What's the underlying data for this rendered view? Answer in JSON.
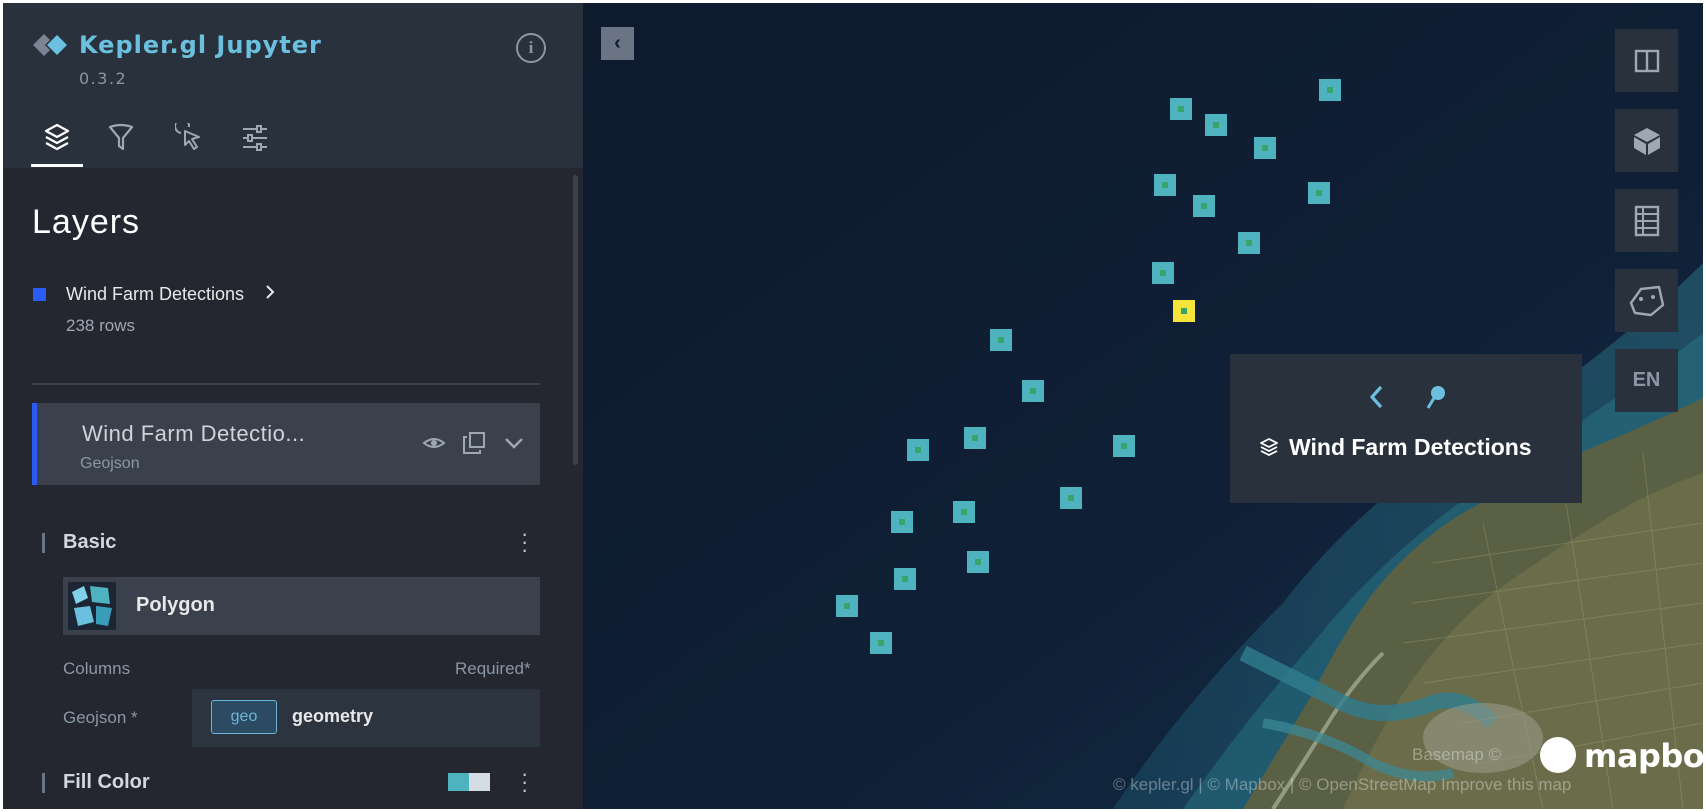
{
  "app": {
    "title": "Kepler.gl Jupyter",
    "version": "0.3.2"
  },
  "tabs": [
    {
      "icon": "layers-icon",
      "active": true
    },
    {
      "icon": "filter-icon",
      "active": false
    },
    {
      "icon": "interaction-icon",
      "active": false
    },
    {
      "icon": "map-settings-icon",
      "active": false
    }
  ],
  "panel": {
    "heading": "Layers",
    "dataset": {
      "name": "Wind Farm Detections",
      "rows": "238 rows",
      "color": "#2a5bf2"
    },
    "layer": {
      "name": "Wind Farm Detectio...",
      "type": "Geojson"
    },
    "basic": {
      "title": "Basic",
      "layer_type": "Polygon"
    },
    "columns": {
      "label": "Columns",
      "required": "Required*",
      "field_label": "Geojson *",
      "tag": "geo",
      "value": "geometry"
    },
    "fill": {
      "title": "Fill Color"
    }
  },
  "map": {
    "lang_button": "EN",
    "tooltip": {
      "title": "Wind Farm Detections"
    },
    "attribution": {
      "basemap": "Basemap ©",
      "credits": "© kepler.gl | © Mapbox | © OpenStreetMap Improve this map",
      "logo": "mapbox"
    },
    "colors": {
      "marker": "#4fb3bf",
      "marker_center": "#3aa36a",
      "highlight": "#f5e53a",
      "accent": "#6bc0e0"
    }
  }
}
